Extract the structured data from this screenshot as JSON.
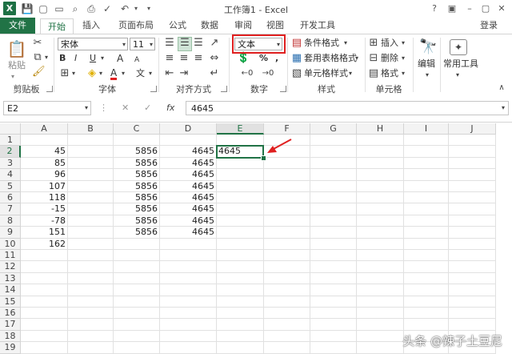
{
  "window": {
    "title": "工作簿1 - Excel",
    "login": "登录"
  },
  "tabs": [
    {
      "label": "文件"
    },
    {
      "label": "开始"
    },
    {
      "label": "插入"
    },
    {
      "label": "页面布局"
    },
    {
      "label": "公式"
    },
    {
      "label": "数据"
    },
    {
      "label": "审阅"
    },
    {
      "label": "视图"
    },
    {
      "label": "开发工具"
    }
  ],
  "ribbon": {
    "clipboard": {
      "paste": "粘贴",
      "label": "剪贴板"
    },
    "font": {
      "name": "宋体",
      "size": "11",
      "bold": "B",
      "italic": "I",
      "underline": "U",
      "grow": "A",
      "shrink": "A",
      "font_color_letter": "A",
      "wen": "文",
      "label": "字体"
    },
    "alignment": {
      "label": "对齐方式"
    },
    "number": {
      "format": "文本",
      "percent": "%",
      "comma": ",",
      "label": "数字"
    },
    "styles": {
      "conditional": "条件格式",
      "table": "套用表格格式",
      "cell_styles": "单元格样式",
      "label": "样式"
    },
    "cells": {
      "insert": "插入",
      "delete": "删除",
      "format": "格式",
      "label": "单元格"
    },
    "editing": {
      "label": "编辑"
    },
    "tools": {
      "label": "常用工具"
    }
  },
  "formula_bar": {
    "name_box": "E2",
    "cancel": "✕",
    "enter": "✓",
    "fx": "fx",
    "value": "4645"
  },
  "sheet": {
    "columns": [
      "A",
      "B",
      "C",
      "D",
      "E",
      "F",
      "G",
      "H",
      "I",
      "J"
    ],
    "rows": [
      "1",
      "2",
      "3",
      "4",
      "5",
      "6",
      "7",
      "8",
      "9",
      "10",
      "11",
      "12",
      "13",
      "14",
      "15",
      "16",
      "17",
      "18",
      "19"
    ],
    "col_a": [
      "45",
      "85",
      "96",
      "107",
      "118",
      "-15",
      "-78",
      "151",
      "162"
    ],
    "col_c": [
      "5856",
      "5856",
      "5856",
      "5856",
      "5856",
      "5856",
      "5856",
      "5856"
    ],
    "col_d": [
      "4645",
      "4645",
      "4645",
      "4645",
      "4645",
      "4645",
      "4645",
      "4645"
    ],
    "e2": "4645"
  },
  "colors": {
    "accent": "#217346",
    "highlight": "#e02020"
  },
  "watermark": "头条 @辣子土豆尼"
}
